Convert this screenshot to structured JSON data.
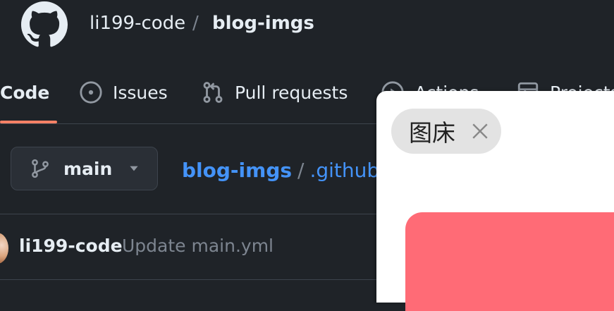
{
  "header": {
    "owner": "li199-code",
    "separator": "/",
    "repo": "blog-imgs"
  },
  "nav": {
    "tabs": [
      {
        "label": "Code",
        "icon": "code-icon",
        "active": true
      },
      {
        "label": "Issues",
        "icon": "issue-icon"
      },
      {
        "label": "Pull requests",
        "icon": "pull-request-icon"
      },
      {
        "label": "Actions",
        "icon": "play-icon"
      },
      {
        "label": "Projects",
        "icon": "table-icon"
      }
    ]
  },
  "branch": {
    "label": "main",
    "icon": "git-branch-icon"
  },
  "path": {
    "repo": "blog-imgs",
    "separator": "/",
    "folder": ".github"
  },
  "commit": {
    "author": "li199-code",
    "message": "Update main.yml"
  },
  "overlay": {
    "chip_label": "图床",
    "card_color": "#ff6b76"
  },
  "colors": {
    "background": "#1f2328",
    "accent_underline": "#f78166",
    "link": "#4493f8"
  }
}
